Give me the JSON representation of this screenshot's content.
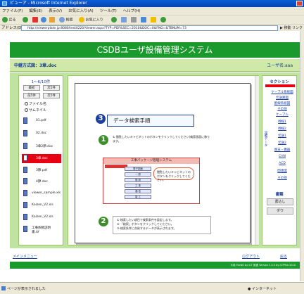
{
  "window": {
    "title": "ビューア - Microsoft Internet Explorer"
  },
  "menubar": {
    "items": [
      "ファイル(F)",
      "編集(E)",
      "表示(V)",
      "お気に入り(A)",
      "ツール(T)",
      "ヘルプ(H)"
    ]
  },
  "toolbar": {
    "back": "戻る",
    "search": "検索",
    "favorites": "お気に入り"
  },
  "address": {
    "label": "アドレス(D)",
    "url": "http://viewerplate.jp:8080/test0220/Viewer.aspx?TYP=PDF&SEC=2010&DOC=0&FNO=&TBNUM=73",
    "go": "移動",
    "links": "リンク"
  },
  "app": {
    "header": "CSDBユーザ設備管理システム",
    "subbar_left": "中継方式図：3章.doc",
    "subbar_right": "ユーザ名:aaa"
  },
  "leftpanel": {
    "title": "1～6/10件",
    "btn_first": "最初",
    "btn_next": "次5件",
    "btn_prev": "前5件",
    "btn_last": "次5件",
    "radio1": "ファイル名",
    "radio2": "サムネイル",
    "files": [
      "01.pdf",
      "02.doc",
      "3章2節.doc",
      "3章.doc",
      "3節.pdf",
      "4節.doc",
      "viewer_sample.xls",
      "Kaizen_V2.xls",
      "Kaizen_V2.xls",
      "工事依頼説明書.tif"
    ]
  },
  "document": {
    "step3_num": "3",
    "title": "データ検索手順",
    "step1_num": "1",
    "step1_text": "① 閲覧したいキャビネットのボタンをクリックしてください(検索画面に移ります。",
    "screenshot_header": "工事パッケージ管理システム",
    "screenshot_buttons": [
      "電子図面",
      "一 般",
      "施 設",
      "工 事",
      "通 信",
      "竣 工"
    ],
    "callout": "閲覧したいキャビネットのボタンをクリックしてください。",
    "step2_num": "2",
    "step2_lines": [
      "① 検索したい項目で検索条件を設定します。",
      "② 「検索」ボタンをクリックしてください。",
      "③ 検索条件に合致するデータが表示されます。"
    ]
  },
  "rightpanel": {
    "section_title": "セクション",
    "links": [
      "ケーブル系統図",
      "伝送路図",
      "配線系統図",
      "その他",
      "ケーブル",
      "幹線1",
      "幹線2",
      "伝送1",
      "伝送2",
      "端末・機器",
      "CHN",
      "ACD",
      "関連図",
      "その他"
    ],
    "vertical_label": "設備データ",
    "bottom_title": "書類",
    "btn1": "書込し",
    "btn2": "ダウ"
  },
  "bottom": {
    "left_link": "メインメニュー",
    "logout": "ログアウト",
    "back": "戻る"
  },
  "footer": {
    "text": "平成 FILING by ICT 推進 Version 3.4.5 by ICTPRA 2010"
  },
  "statusbar": {
    "text": "ページが表示されました",
    "zone": "インターネット"
  }
}
